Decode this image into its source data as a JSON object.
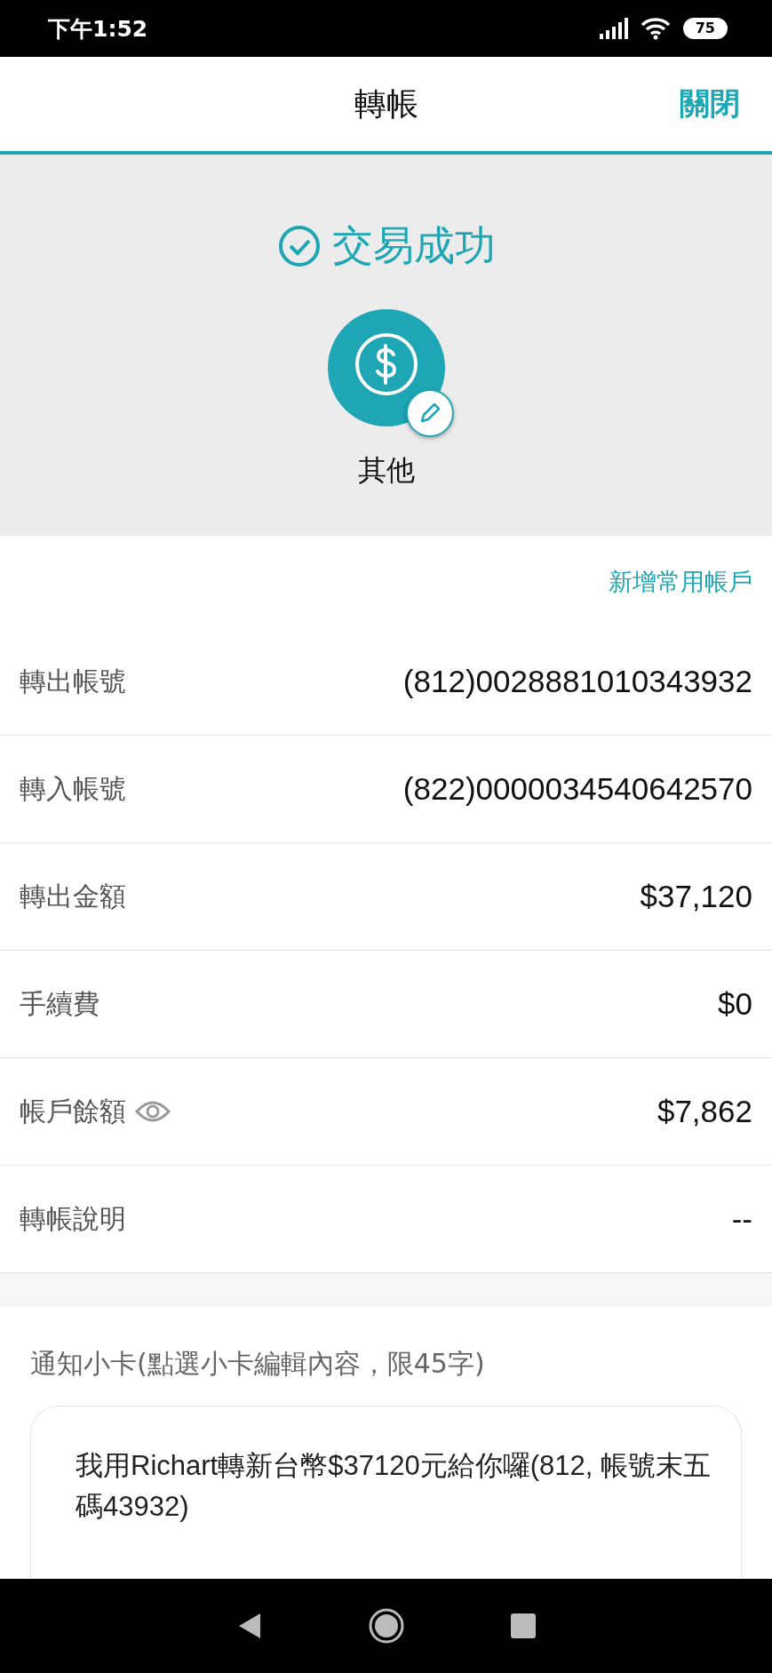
{
  "status_bar": {
    "time": "下午1:52",
    "battery": "75"
  },
  "header": {
    "title": "轉帳",
    "close": "關閉"
  },
  "result": {
    "message": "交易成功",
    "category": "其他"
  },
  "add_account": "新增常用帳戶",
  "details": [
    {
      "kind": "plain",
      "label": "轉出帳號",
      "value": "(812)0028881010343932"
    },
    {
      "kind": "plain",
      "label": "轉入帳號",
      "value": "(822)0000034540642570"
    },
    {
      "kind": "plain",
      "label": "轉出金額",
      "value": "$37,120"
    },
    {
      "kind": "plain",
      "label": "手續費",
      "value": "$0"
    },
    {
      "kind": "reveal",
      "label": "帳戶餘額",
      "value": "$7,862"
    },
    {
      "kind": "plain",
      "label": "轉帳說明",
      "value": "--"
    }
  ],
  "notice": {
    "label": "通知小卡(點選小卡編輯內容，限45字)",
    "card_text": "我用Richart轉新台幣$37120元給你囉(812, 帳號末五碼43932)"
  }
}
